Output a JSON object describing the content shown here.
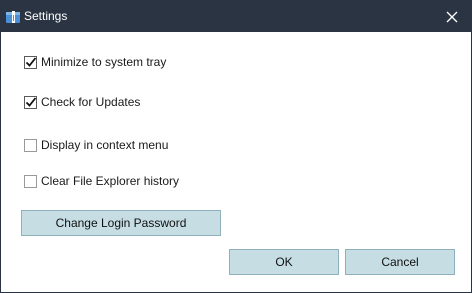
{
  "window": {
    "title": "Settings",
    "title_icon": "settings-app-icon",
    "close_icon": "close-icon",
    "titlebar_color": "#2b3442"
  },
  "options": [
    {
      "label": "Minimize to system tray",
      "checked": true
    },
    {
      "label": "Check for Updates",
      "checked": true
    },
    {
      "label": "Display in context menu",
      "checked": false
    },
    {
      "label": "Clear File Explorer history",
      "checked": false
    }
  ],
  "buttons": {
    "change_password": "Change Login Password",
    "ok": "OK",
    "cancel": "Cancel",
    "button_color": "#c6dde4"
  }
}
